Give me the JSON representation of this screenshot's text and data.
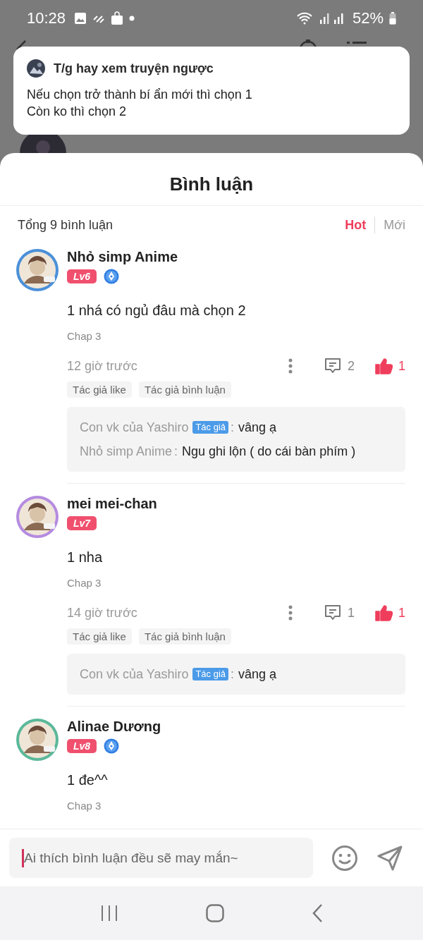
{
  "status_bar": {
    "time": "10:28",
    "battery": "52%"
  },
  "notification": {
    "title": "T/g hay xem truyện ngược",
    "lines": [
      "Nếu chọn trở thành bí ẩn mới thì chọn 1",
      "Còn ko thì chọn 2"
    ]
  },
  "sheet": {
    "title": "Bình luận",
    "total": "Tổng 9 bình luận",
    "sort_tabs": [
      {
        "label": "Hot",
        "selected": true
      },
      {
        "label": "Mới",
        "selected": false
      }
    ]
  },
  "comments": [
    {
      "user": "Nhỏ simp Anime",
      "level": "Lv6",
      "author_badge": true,
      "text": "1 nhá có ngủ đâu mà chọn 2",
      "chapter": "Chap 3",
      "time": "12 giờ trước",
      "reply_count": "2",
      "like_count": "1",
      "liked": true,
      "tags": [
        "Tác giả like",
        "Tác giả bình luận"
      ],
      "replies": [
        {
          "user": "Con vk của Yashiro",
          "author_label": "Tác giả",
          "separator": ":",
          "text": "vâng ạ"
        },
        {
          "user": "Nhỏ simp Anime",
          "separator": ":",
          "text": "Ngu ghi lộn ( do cái bàn phím )"
        }
      ]
    },
    {
      "user": "mei mei-chan",
      "level": "Lv7",
      "author_badge": false,
      "text": "1 nha",
      "chapter": "Chap 3",
      "time": "14 giờ trước",
      "reply_count": "1",
      "like_count": "1",
      "liked": true,
      "tags": [
        "Tác giả like",
        "Tác giả bình luận"
      ],
      "replies": [
        {
          "user": "Con vk của Yashiro",
          "author_label": "Tác giả",
          "separator": ":",
          "text": "vâng ạ"
        }
      ]
    },
    {
      "user": "Alinae Dương",
      "level": "Lv8",
      "author_badge": true,
      "text": "1 đe^^",
      "chapter": "Chap 3"
    }
  ],
  "composer": {
    "placeholder": "Ai thích bình luận đều sẽ may mắn~"
  }
}
